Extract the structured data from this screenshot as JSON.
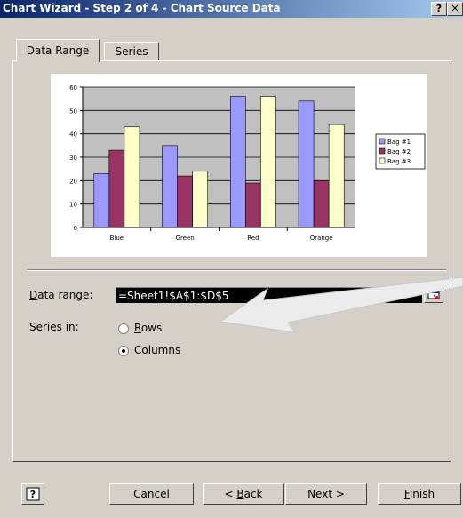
{
  "window": {
    "title": "Chart Wizard - Step 2 of 4 - Chart Source Data",
    "help_glyph": "?",
    "close_glyph": "✕"
  },
  "tabs": [
    {
      "label": "Data Range",
      "active": true
    },
    {
      "label": "Series",
      "active": false
    }
  ],
  "chart_data": {
    "type": "bar",
    "categories": [
      "Blue",
      "Green",
      "Red",
      "Orange"
    ],
    "series": [
      {
        "name": "Bag #1",
        "values": [
          23,
          35,
          56,
          54
        ],
        "color": "#9999ff"
      },
      {
        "name": "Bag #2",
        "values": [
          33,
          22,
          19,
          20
        ],
        "color": "#993366"
      },
      {
        "name": "Bag #3",
        "values": [
          43,
          24,
          56,
          44
        ],
        "color": "#ffffcc"
      }
    ],
    "ylim": [
      0,
      60
    ],
    "yticks": [
      0,
      10,
      20,
      30,
      40,
      50,
      60
    ],
    "grid": true,
    "legend": "right",
    "title": "",
    "xlabel": "",
    "ylabel": ""
  },
  "form": {
    "data_range_label_accel": "D",
    "data_range_label_rest": "ata range:",
    "data_range_value": "=Sheet1!$A$1:$D$5",
    "series_in_label": "Series in:",
    "rows_accel": "R",
    "rows_rest": "ows",
    "columns_pre": "Co",
    "columns_accel": "l",
    "columns_rest": "umns",
    "selected": "Columns"
  },
  "buttons": {
    "help_icon": "question-mark",
    "cancel": "Cancel",
    "back_pre": "< ",
    "back_accel": "B",
    "back_rest": "ack",
    "next": "Next >",
    "finish_accel": "F",
    "finish_rest": "inish"
  },
  "colors": {
    "dialog_face": "#d4d0c8",
    "title_start": "#0a246a",
    "title_end": "#a6caf0",
    "plot_area": "#c0c0c0"
  }
}
